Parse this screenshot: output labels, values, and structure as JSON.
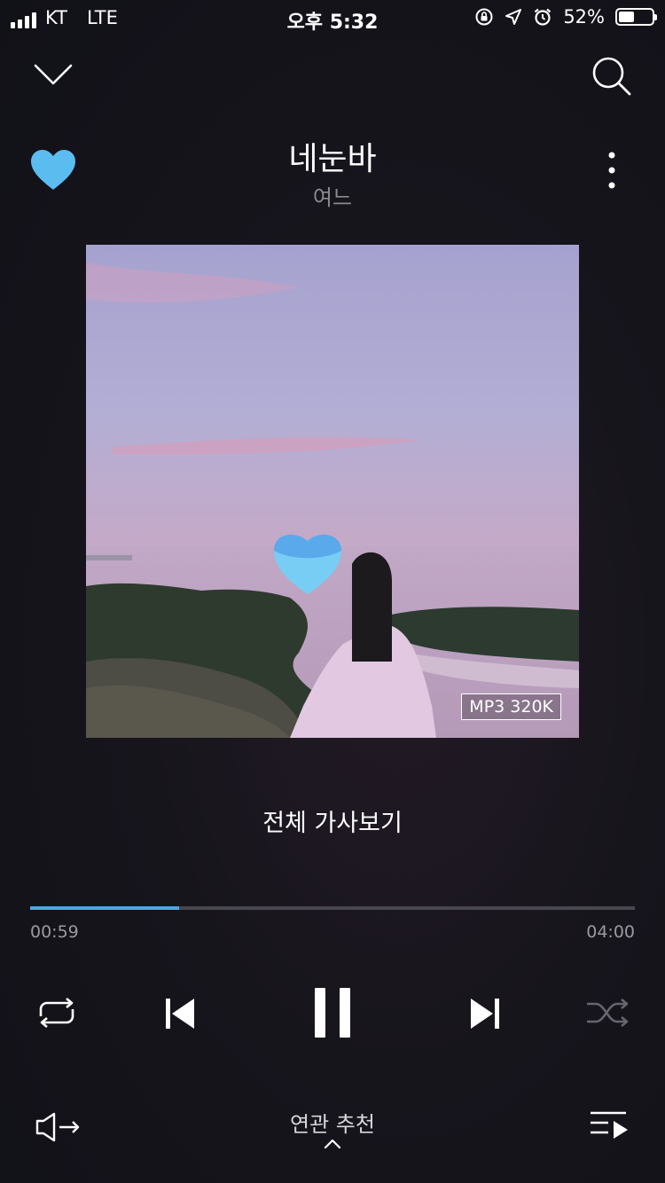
{
  "status_bar": {
    "carrier": "KT",
    "network": "LTE",
    "time": "오후 5:32",
    "battery_percent": "52%",
    "battery_level": 0.52
  },
  "player": {
    "song_title": "네눈바",
    "artist": "여느",
    "quality_badge": "MP3 320K",
    "lyrics_button": "전체 가사보기",
    "elapsed": "00:59",
    "duration": "04:00",
    "progress": 0.246,
    "recommend_label": "연관 추천"
  },
  "colors": {
    "accent": "#4fa6e0",
    "heart": "#5bbcf0"
  },
  "icons": {
    "collapse": "chevron-down-icon",
    "search": "search-icon",
    "like": "heart-icon",
    "more": "more-vertical-icon",
    "repeat": "repeat-icon",
    "previous": "skip-previous-icon",
    "pause": "pause-icon",
    "next": "skip-next-icon",
    "shuffle": "shuffle-icon",
    "output": "audio-output-icon",
    "expand": "chevron-up-icon",
    "playlist": "playlist-icon"
  }
}
